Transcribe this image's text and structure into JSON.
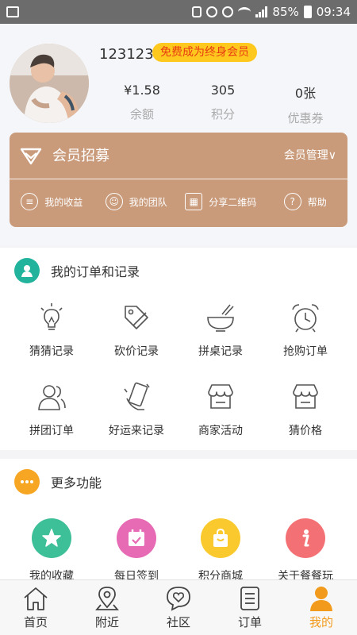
{
  "status_bar": {
    "battery": "85%",
    "time": "09:34"
  },
  "profile": {
    "username": "123123",
    "vip_badge": "免费成为终身会员",
    "stats": [
      {
        "value": "¥1.58",
        "label": "余额"
      },
      {
        "value": "305",
        "label": "积分"
      },
      {
        "value": "0张",
        "label": "优惠券"
      }
    ]
  },
  "member_card": {
    "title": "会员招募",
    "manage": "会员管理∨",
    "links": [
      {
        "label": "我的收益",
        "icon": "receipt-icon"
      },
      {
        "label": "我的团队",
        "icon": "team-icon"
      },
      {
        "label": "分享二维码",
        "icon": "qr-icon"
      },
      {
        "label": "帮助",
        "icon": "help-icon"
      }
    ],
    "color": "#c99b7b"
  },
  "orders": {
    "title": "我的订单和记录",
    "items": [
      {
        "label": "猜猜记录",
        "icon": "lightbulb-icon"
      },
      {
        "label": "砍价记录",
        "icon": "price-tag-icon"
      },
      {
        "label": "拼桌记录",
        "icon": "bowl-icon"
      },
      {
        "label": "抢购订单",
        "icon": "alarm-clock-icon"
      },
      {
        "label": "拼团订单",
        "icon": "group-icon"
      },
      {
        "label": "好运来记录",
        "icon": "phone-hand-icon"
      },
      {
        "label": "商家活动",
        "icon": "shop-icon"
      },
      {
        "label": "猜价格",
        "icon": "shop-icon"
      }
    ]
  },
  "more": {
    "title": "更多功能",
    "items": [
      {
        "label": "我的收藏",
        "icon": "star-icon",
        "color": "#3dbf97"
      },
      {
        "label": "每日签到",
        "icon": "calendar-check-icon",
        "color": "#e76ab4"
      },
      {
        "label": "积分商城",
        "icon": "shopping-bag-icon",
        "color": "#f9c92e"
      },
      {
        "label": "关于餐餐玩",
        "icon": "info-icon",
        "color": "#f37174"
      }
    ]
  },
  "tabs": [
    {
      "label": "首页",
      "icon": "home-icon"
    },
    {
      "label": "附近",
      "icon": "location-icon"
    },
    {
      "label": "社区",
      "icon": "heart-chat-icon"
    },
    {
      "label": "订单",
      "icon": "list-icon"
    },
    {
      "label": "我的",
      "icon": "person-icon",
      "active": true
    }
  ],
  "accent_color": "#f29a1b"
}
